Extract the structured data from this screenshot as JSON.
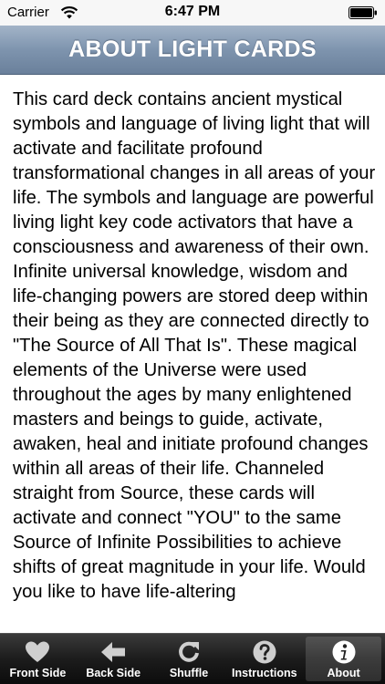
{
  "status_bar": {
    "carrier": "Carrier",
    "time": "6:47 PM"
  },
  "nav_bar": {
    "title": "ABOUT LIGHT CARDS"
  },
  "content": {
    "body": "This card deck contains ancient mystical symbols and language of living light that will activate and facilitate profound transformational changes in all areas of your life. The symbols and language are powerful living light key code activators that have a consciousness and awareness of their own. Infinite universal knowledge, wisdom and life-changing powers are stored deep within their being as they are connected directly to \"The Source of All That Is\". These magical elements of the Universe were used throughout the ages by many enlightened masters and beings to guide, activate, awaken, heal and initiate profound changes within all areas of their life. Channeled straight from Source, these cards will activate and connect \"YOU\" to the same Source of Infinite Possibilities to achieve shifts of great magnitude in your life. Would you like to have life-altering"
  },
  "tab_bar": {
    "tabs": [
      {
        "label": "Front Side",
        "icon": "heart-icon"
      },
      {
        "label": "Back Side",
        "icon": "arrow-left-icon"
      },
      {
        "label": "Shuffle",
        "icon": "refresh-icon"
      },
      {
        "label": "Instructions",
        "icon": "question-icon"
      },
      {
        "label": "About",
        "icon": "info-icon",
        "selected": true
      }
    ]
  }
}
